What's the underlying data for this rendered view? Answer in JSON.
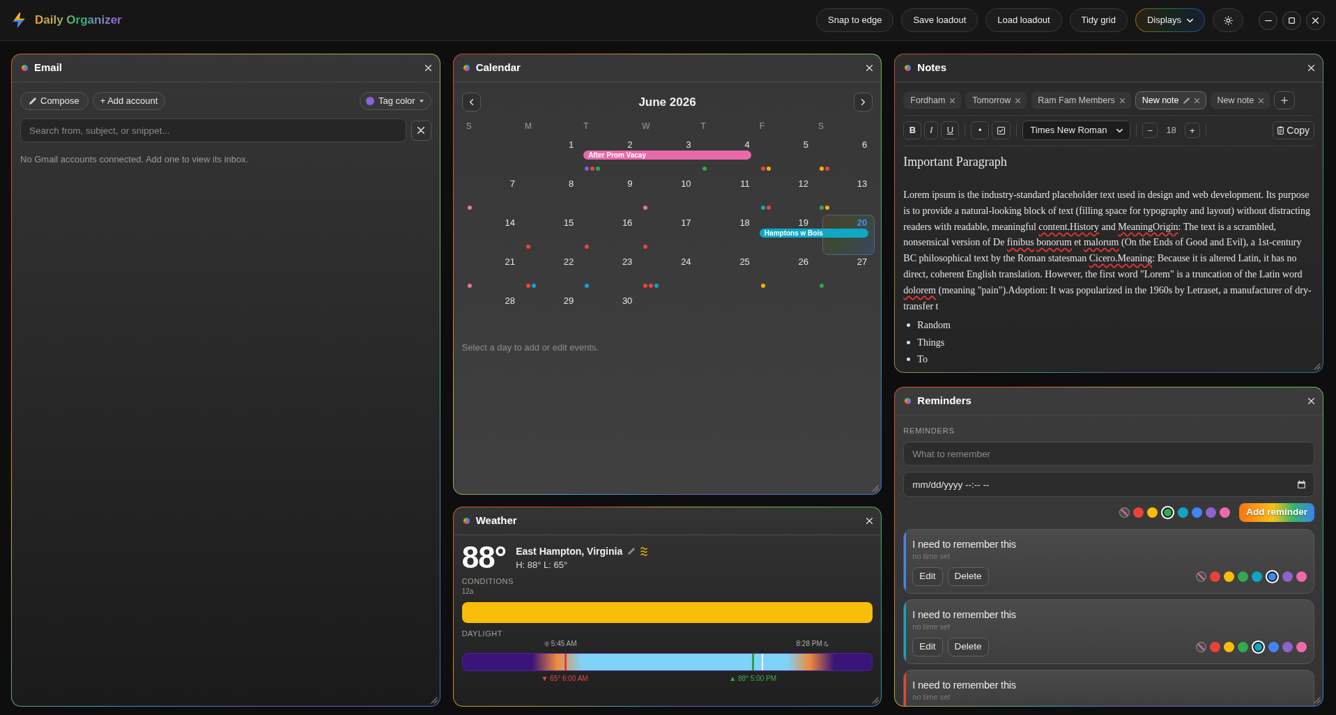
{
  "header": {
    "title": "Daily Organizer",
    "actions": [
      "Snap to edge",
      "Save loadout",
      "Load loadout",
      "Tidy grid"
    ],
    "displays": "Displays"
  },
  "email": {
    "title": "Email",
    "compose": "Compose",
    "add_account": "+ Add account",
    "tag_color": {
      "label": "Tag color",
      "color": "#8b63d6"
    },
    "search": {
      "placeholder": "Search from, subject, or snippet..."
    },
    "message": "No Gmail accounts connected. Add one to view its inbox."
  },
  "calendar": {
    "title": "Calendar",
    "month": "June 2026",
    "weekdays": [
      "S",
      "M",
      "T",
      "W",
      "T",
      "F",
      "S"
    ],
    "weeks": [
      [
        {
          "kind": "blank"
        },
        {
          "kind": "day",
          "day": "1",
          "today": false
        },
        {
          "kind": "event",
          "event": {
            "label": "After Prom Vacay",
            "color": "#e96aaa"
          },
          "days": [
            {
              "kind": "day",
              "day": "2",
              "today": false,
              "dots": [
                {
                  "color": "#7f5fd6"
                },
                {
                  "color": "#e8453c"
                },
                {
                  "color": "#2fa84f"
                }
              ]
            },
            {
              "kind": "day",
              "day": "3",
              "today": false
            },
            {
              "kind": "day",
              "day": "4",
              "today": false,
              "dots": [
                {
                  "color": "#2fa84f"
                }
              ]
            }
          ]
        },
        {
          "kind": "day",
          "day": "5",
          "today": false,
          "dots": [
            {
              "color": "#e8453c"
            },
            {
              "color": "#f5b400"
            }
          ]
        },
        {
          "kind": "day",
          "day": "6",
          "today": false,
          "dots": [
            {
              "color": "#f5b400"
            },
            {
              "color": "#e8453c"
            }
          ]
        }
      ],
      [
        {
          "kind": "day",
          "day": "7",
          "today": false,
          "dots": [
            {
              "color": "#ee6fae"
            }
          ]
        },
        {
          "kind": "day",
          "day": "8",
          "today": false
        },
        {
          "kind": "day",
          "day": "9",
          "today": false
        },
        {
          "kind": "day",
          "day": "10",
          "today": false,
          "dots": [
            {
              "color": "#ee6fae"
            }
          ]
        },
        {
          "kind": "day",
          "day": "11",
          "today": false
        },
        {
          "kind": "day",
          "day": "12",
          "today": false,
          "dots": [
            {
              "color": "#12a6c6"
            },
            {
              "color": "#e8453c"
            }
          ]
        },
        {
          "kind": "day",
          "day": "13",
          "today": false,
          "dots": [
            {
              "color": "#2fa84f"
            },
            {
              "color": "#f5b400"
            }
          ]
        }
      ],
      [
        {
          "kind": "day",
          "day": "14",
          "today": false
        },
        {
          "kind": "day",
          "day": "15",
          "today": false,
          "dots": [
            {
              "color": "#e8453c"
            }
          ]
        },
        {
          "kind": "day",
          "day": "16",
          "today": false,
          "dots": [
            {
              "color": "#e8453c"
            }
          ]
        },
        {
          "kind": "day",
          "day": "17",
          "today": false,
          "dots": [
            {
              "color": "#e8453c"
            }
          ]
        },
        {
          "kind": "day",
          "day": "18",
          "today": false
        },
        {
          "kind": "event",
          "event": {
            "label": "Hamptons w Bois",
            "color": "#0ea8c4"
          },
          "days": [
            {
              "kind": "day",
              "day": "19",
              "today": false
            },
            {
              "kind": "day",
              "day": "20",
              "today": true
            }
          ]
        }
      ],
      [
        {
          "kind": "day",
          "day": "21",
          "today": false,
          "dots": [
            {
              "color": "#ee6fae"
            }
          ]
        },
        {
          "kind": "day",
          "day": "22",
          "today": false,
          "dots": [
            {
              "color": "#e8453c"
            },
            {
              "color": "#12a6c6"
            }
          ]
        },
        {
          "kind": "day",
          "day": "23",
          "today": false,
          "dots": [
            {
              "color": "#12a6c6"
            }
          ]
        },
        {
          "kind": "day",
          "day": "24",
          "today": false,
          "dots": [
            {
              "color": "#e8453c"
            },
            {
              "color": "#e8453c"
            },
            {
              "color": "#12a6c6"
            }
          ]
        },
        {
          "kind": "day",
          "day": "25",
          "today": false
        },
        {
          "kind": "day",
          "day": "26",
          "today": false,
          "dots": [
            {
              "color": "#f5b400"
            }
          ]
        },
        {
          "kind": "day",
          "day": "27",
          "today": false,
          "dots": [
            {
              "color": "#2fa84f"
            }
          ]
        }
      ],
      [
        {
          "kind": "day",
          "day": "28",
          "today": false
        },
        {
          "kind": "day",
          "day": "29",
          "today": false
        },
        {
          "kind": "day",
          "day": "30",
          "today": false
        }
      ]
    ],
    "hint": "Select a day to add or edit events."
  },
  "weather": {
    "title": "Weather",
    "temperature": "88°",
    "location": "East Hampton, Virginia",
    "high_low": "H: 88° L: 65°",
    "conditions": {
      "label": "CONDITIONS",
      "start": "12a",
      "segments": [
        {
          "color": "#f8bd08"
        }
      ]
    },
    "daylight": {
      "label": "DAYLIGHT",
      "sunrise": {
        "time": "5:45 AM",
        "level": 0.24
      },
      "sunset": {
        "time": "8:28 PM",
        "level": 0.853
      },
      "markers": [
        {
          "kind": "low",
          "text": "▼ 65° 6:00 AM",
          "level": 0.25
        },
        {
          "kind": "high",
          "text": "▲ 88° 5:00 PM",
          "level": 0.708
        },
        {
          "kind": "now",
          "level": 0.733
        }
      ]
    }
  },
  "notes": {
    "title": "Notes",
    "tabs": [
      {
        "label": "Fordham",
        "selected": false
      },
      {
        "label": "Tomorrow",
        "selected": false
      },
      {
        "label": "Ram Fam Members",
        "selected": false
      },
      {
        "label": "New note",
        "selected": true
      },
      {
        "label": "New note",
        "selected": false
      }
    ],
    "format_buttons": [
      {
        "kind": "bold",
        "label": "B"
      },
      {
        "kind": "italic",
        "label": "I"
      },
      {
        "kind": "underline",
        "label": "U"
      }
    ],
    "list_buttons": [
      {
        "kind": "bullet",
        "label": "•"
      },
      {
        "kind": "checklist"
      }
    ],
    "font": "Times New Roman",
    "size": {
      "decrease": "−",
      "value": "18",
      "increase": "+"
    },
    "copy": "Copy",
    "heading": "Important Paragraph",
    "paragraph": [
      {
        "text": "Lorem ipsum is the industry-standard placeholder text used in design and web development. Its purpose is to provide a natural-looking block of text (filling space for typography and layout) without distracting readers with readable, meaningful ",
        "misspelled": false
      },
      {
        "text": "content.History",
        "misspelled": true
      },
      {
        "text": " and ",
        "misspelled": false
      },
      {
        "text": "MeaningOrigin",
        "misspelled": true
      },
      {
        "text": ": The text is a scrambled, nonsensical version of De ",
        "misspelled": false
      },
      {
        "text": "finibus",
        "misspelled": true
      },
      {
        "text": " bonorum",
        "misspelled": true
      },
      {
        "text": " et ",
        "misspelled": false
      },
      {
        "text": "malorum",
        "misspelled": true
      },
      {
        "text": " (On the Ends of Good and Evil), a 1st-century BC philosophical text by the Roman statesman ",
        "misspelled": false
      },
      {
        "text": "Cicero.Meaning",
        "misspelled": true
      },
      {
        "text": ": Because it is altered Latin, it has no direct, coherent English translation. However, the first word \"Lorem\" is a truncation of the Latin word ",
        "misspelled": false
      },
      {
        "text": "dolorem",
        "misspelled": true
      },
      {
        "text": " (meaning \"pain\").Adoption: It was popularized in the 1960s by Letraset, a manufacturer of dry-transfer t",
        "misspelled": false
      }
    ],
    "bullets": [
      "Random",
      "Things",
      "To"
    ]
  },
  "reminders": {
    "title": "Reminders",
    "section": "REMINDERS",
    "input": {
      "placeholder": "What to remember"
    },
    "datetime": {
      "placeholder": "mm/dd/yyyy --:-- --"
    },
    "swatches": [
      {
        "kind": "none",
        "selected": false
      },
      {
        "kind": "color",
        "color": "#ea4335",
        "selected": false
      },
      {
        "kind": "color",
        "color": "#fbbc04",
        "selected": false
      },
      {
        "kind": "color",
        "color": "#34a853",
        "selected": true
      },
      {
        "kind": "color",
        "color": "#12a4c4",
        "selected": false
      },
      {
        "kind": "color",
        "color": "#4285f4",
        "selected": false
      },
      {
        "kind": "color",
        "color": "#8e63ce",
        "selected": false
      },
      {
        "kind": "color",
        "color": "#f06aaa",
        "selected": false
      }
    ],
    "add": "Add reminder",
    "items": [
      {
        "title": "I need to remember this",
        "time": "no time set",
        "color": "#4285f4",
        "edit": "Edit",
        "delete": "Delete",
        "swatches": [
          {
            "kind": "none",
            "selected": false
          },
          {
            "kind": "color",
            "color": "#ea4335",
            "selected": false
          },
          {
            "kind": "color",
            "color": "#fbbc04",
            "selected": false
          },
          {
            "kind": "color",
            "color": "#34a853",
            "selected": false
          },
          {
            "kind": "color",
            "color": "#12a4c4",
            "selected": false
          },
          {
            "kind": "color",
            "color": "#4285f4",
            "selected": true
          },
          {
            "kind": "color",
            "color": "#8e63ce",
            "selected": false
          },
          {
            "kind": "color",
            "color": "#f06aaa",
            "selected": false
          }
        ]
      },
      {
        "title": "I need to remember this",
        "time": "no time set",
        "color": "#12a4c4",
        "edit": "Edit",
        "delete": "Delete",
        "swatches": [
          {
            "kind": "none",
            "selected": false
          },
          {
            "kind": "color",
            "color": "#ea4335",
            "selected": false
          },
          {
            "kind": "color",
            "color": "#fbbc04",
            "selected": false
          },
          {
            "kind": "color",
            "color": "#34a853",
            "selected": false
          },
          {
            "kind": "color",
            "color": "#12a4c4",
            "selected": true
          },
          {
            "kind": "color",
            "color": "#4285f4",
            "selected": false
          },
          {
            "kind": "color",
            "color": "#8e63ce",
            "selected": false
          },
          {
            "kind": "color",
            "color": "#f06aaa",
            "selected": false
          }
        ]
      },
      {
        "title": "I need to remember this",
        "time": "no time set",
        "color": "#ea4335"
      }
    ]
  }
}
